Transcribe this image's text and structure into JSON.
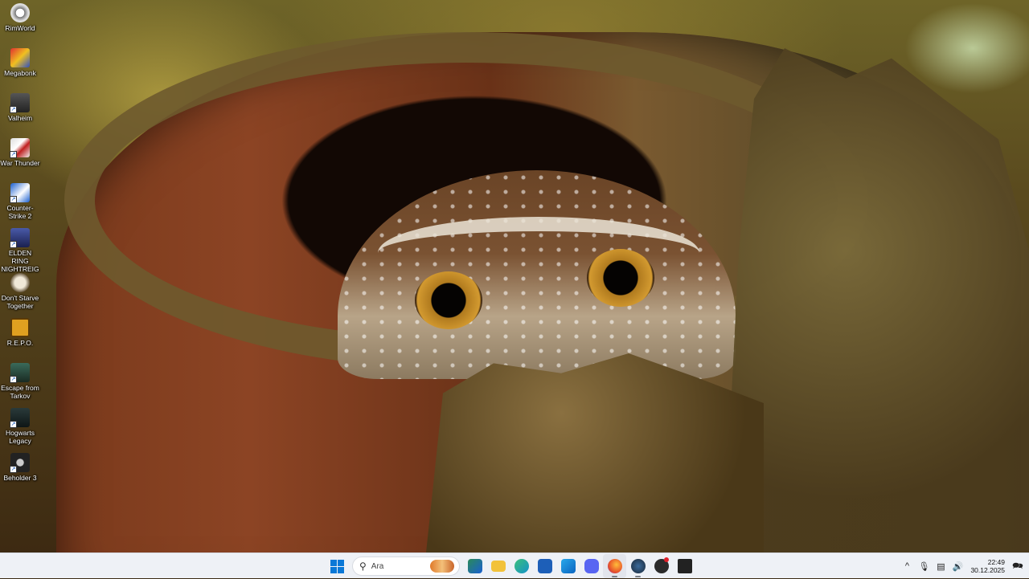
{
  "desktop": {
    "icons": [
      {
        "label": "RimWorld",
        "icon": "rimworld-icon"
      },
      {
        "label": "Megabonk",
        "icon": "megabonk-icon"
      },
      {
        "label": "Valheim",
        "icon": "valheim-icon"
      },
      {
        "label": "War Thunder",
        "icon": "war-thunder-icon"
      },
      {
        "label": "Counter-Strike 2",
        "icon": "counter-strike-icon"
      },
      {
        "label": "ELDEN RING NIGHTREIGN",
        "icon": "elden-ring-icon"
      },
      {
        "label": "Don't Starve Together",
        "icon": "dont-starve-icon"
      },
      {
        "label": "R.E.P.O.",
        "icon": "repo-icon"
      },
      {
        "label": "Escape from Tarkov",
        "icon": "tarkov-icon"
      },
      {
        "label": "Hogwarts Legacy",
        "icon": "hogwarts-icon"
      },
      {
        "label": "Beholder 3",
        "icon": "beholder-icon"
      }
    ]
  },
  "taskbar": {
    "search_placeholder": "Ara",
    "apps": [
      {
        "name": "widgets",
        "icon": "copilot-icon",
        "color": "#2a8a5a"
      },
      {
        "name": "file-explorer",
        "icon": "folder-icon",
        "color": "#f2c23a"
      },
      {
        "name": "edge",
        "icon": "edge-icon",
        "color": "#1592c9"
      },
      {
        "name": "store",
        "icon": "store-icon",
        "color": "#1d5fb8"
      },
      {
        "name": "outlook",
        "icon": "outlook-icon",
        "color": "#0a64c0"
      },
      {
        "name": "discord",
        "icon": "discord-icon",
        "color": "#5865f2"
      },
      {
        "name": "firefox",
        "icon": "firefox-icon",
        "color": "#e8532a"
      },
      {
        "name": "steam",
        "icon": "steam-icon",
        "color": "#1b2838"
      },
      {
        "name": "obs",
        "icon": "obs-icon",
        "color": "#2b2b2b"
      },
      {
        "name": "epic-games",
        "icon": "epic-games-icon",
        "color": "#222222"
      }
    ],
    "clock": {
      "time": "22:49",
      "date": "30.12.2025"
    }
  }
}
